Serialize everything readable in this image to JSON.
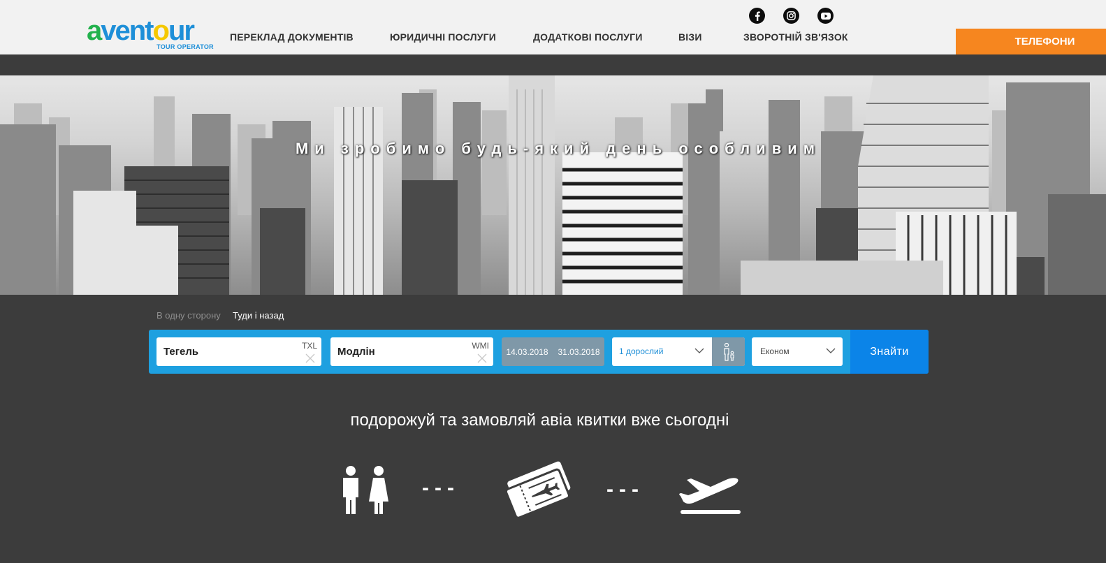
{
  "brand": {
    "logo_main": "aventour",
    "logo_sub": "TOUR OPERATOR"
  },
  "nav": {
    "items": [
      {
        "label": "ПЕРЕКЛАД ДОКУМЕНТІВ"
      },
      {
        "label": "ЮРИДИЧНІ ПОСЛУГИ"
      },
      {
        "label": "ДОДАТКОВІ ПОСЛУГИ"
      },
      {
        "label": "ВІЗИ"
      },
      {
        "label": "ЗВОРОТНІЙ ЗВ'ЯЗОК"
      }
    ],
    "phones_label": "ТЕЛЕФОНИ",
    "social": [
      "facebook-icon",
      "instagram-icon",
      "youtube-icon"
    ]
  },
  "hero": {
    "headline": "Ми зробимо будь-який день особливим"
  },
  "search": {
    "trip_types": [
      {
        "label": "В одну сторону",
        "active": false
      },
      {
        "label": "Туди і назад",
        "active": true
      }
    ],
    "from": {
      "city": "Тегель",
      "code": "TXL"
    },
    "to": {
      "city": "Модлін",
      "code": "WMI"
    },
    "depart_date": "14.03.2018",
    "return_date": "31.03.2018",
    "passengers": "1 дорослий",
    "cabin": "Економ",
    "submit_label": "Знайти"
  },
  "tagline": "подорожуй та замовляй авіа квитки вже сьогодні",
  "steps": {
    "icons": [
      "passengers-icon",
      "tickets-icon",
      "departure-plane-icon"
    ],
    "separator": "---"
  },
  "colors": {
    "accent_orange": "#f6861f",
    "search_blue": "#1ea0e0",
    "button_blue": "#0b84e8",
    "page_bg": "#3c3c3c",
    "date_grey": "#7f98a8"
  }
}
